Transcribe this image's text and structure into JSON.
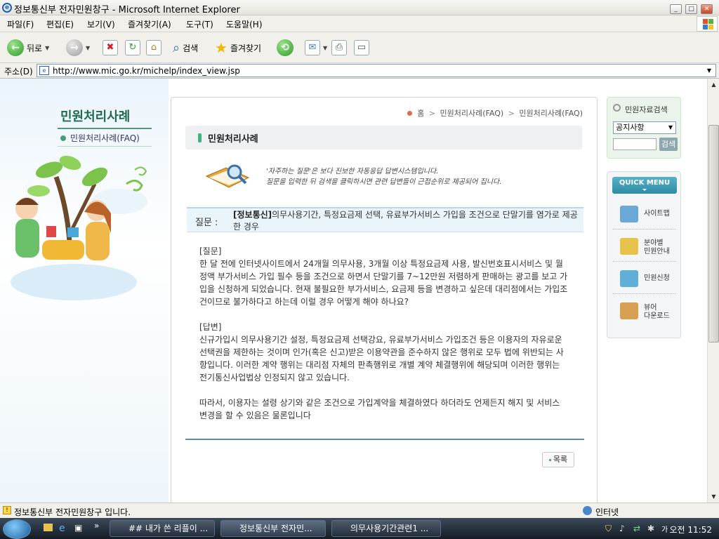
{
  "window": {
    "title": "정보통신부 전자민원창구 - Microsoft Internet Explorer"
  },
  "menu": [
    "파일(F)",
    "편집(E)",
    "보기(V)",
    "즐겨찾기(A)",
    "도구(T)",
    "도움말(H)"
  ],
  "toolbar": {
    "back": "뒤로",
    "search": "검색",
    "favorites": "즐겨찾기"
  },
  "address": {
    "label": "주소(D)",
    "url": "http://www.mic.go.kr/michelp/index_view.jsp"
  },
  "sidebar": {
    "title": "민원처리사례",
    "link": "민원처리사례(FAQ)"
  },
  "breadcrumb": {
    "home": "홈",
    "level1": "민원처리사례(FAQ)",
    "level2": "민원처리사례(FAQ)"
  },
  "page": {
    "title": "민원처리사례",
    "intro_line1": "'자주하는 질문'은 보다 진보한 자동응답 답변시스템입니다.",
    "intro_line2": "질문을 입력한 뒤 검색을 클릭하시면 관련 답변들이 근접순위로 제공되어 집니다.",
    "question_label": "질문 :",
    "question_tag": "[정보통신]",
    "question_text": "의무사용기간, 특정요금제 선택, 유료부가서비스 가입을 조건으로 단말기를 염가로 제공한 경우",
    "q_heading": "[질문]",
    "q_body": "한 달 전에 인터넷사이트에서 24개월 의무사용, 3개월 이상 특정요금제 사용, 발신번호표시서비스 및 월정액 부가서비스 가입 필수 등을 조건으로 하면서 단말기를 7~12만원 저렴하게 판매하는 광고를 보고 가입을 신청하게 되었습니다. 현재 불필요한 부가서비스, 요금제 등을 변경하고 싶은데 대리점에서는 가입조건이므로 불가하다고 하는데 이럴 경우 어떻게 해야 하나요?",
    "a_heading": "[답변]",
    "a_body": "신규가입시 의무사용기간 설정, 특정요금제 선택강요, 유료부가서비스 가입조건 등은 이용자의 자유로운 선택권을 제한하는 것이며 인가(혹은 신고)받은 이용약관을 준수하지 않은 행위로 모두 법에 위반되는 사항입니다. 이러한 계약 행위는 대리점 자체의 판촉행위로 개별 계약 체결행위에 해당되며 이러한 행위는 전기통신사업법상 인정되지 않고 있습니다.",
    "a_conclusion": "따라서, 이용자는 설령 상기와 같은 조건으로 가입계약을 체결하였다 하더라도 언제든지 해지 및 서비스 변경을 할 수 있음은 물론입니다",
    "list_button": "목록"
  },
  "right": {
    "search_title": "민원자료검색",
    "select_value": "공지사항",
    "search_button": "검색",
    "quick_menu": "QUICK MENU",
    "quick_items": [
      {
        "label": "사이트맵",
        "color": "#6aa8d8"
      },
      {
        "label": "분야별\n민원안내",
        "color": "#e8c24a"
      },
      {
        "label": "민원신청",
        "color": "#5fb0d8"
      },
      {
        "label": "뷰어\n다운로드",
        "color": "#d8a050"
      }
    ]
  },
  "status": {
    "text": "정보통신부 전자민원창구 입니다.",
    "zone": "인터넷"
  },
  "taskbar": {
    "tasks": [
      "## 내가 쓴 리플이 ...",
      "정보통신부 전자민...",
      "의무사용기간관련1 ..."
    ],
    "clock": "오전 11:52"
  },
  "colors": {
    "accent": "#3eb37a",
    "question_bg": "#e9f4fb",
    "quick_menu": "#2f8aa3"
  }
}
